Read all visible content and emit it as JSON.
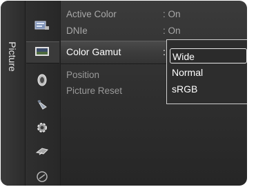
{
  "osd": {
    "category_label": "Picture",
    "icons": [
      {
        "name": "input-icon"
      },
      {
        "name": "picture-icon"
      },
      {
        "name": "sound-icon"
      },
      {
        "name": "channel-icon"
      },
      {
        "name": "setup-icon"
      },
      {
        "name": "support-icon"
      },
      {
        "name": "help-icon"
      }
    ],
    "menu_items": [
      {
        "label": "Active Color",
        "value": ": On"
      },
      {
        "label": "DNIe",
        "value": ": On"
      },
      {
        "label": "Color Gamut",
        "value": ":"
      },
      {
        "label": "Position",
        "value": ""
      },
      {
        "label": "Picture Reset",
        "value": ""
      }
    ],
    "dropdown": {
      "options": [
        "Wide",
        "Normal",
        "sRGB"
      ],
      "selected": "Wide"
    }
  }
}
